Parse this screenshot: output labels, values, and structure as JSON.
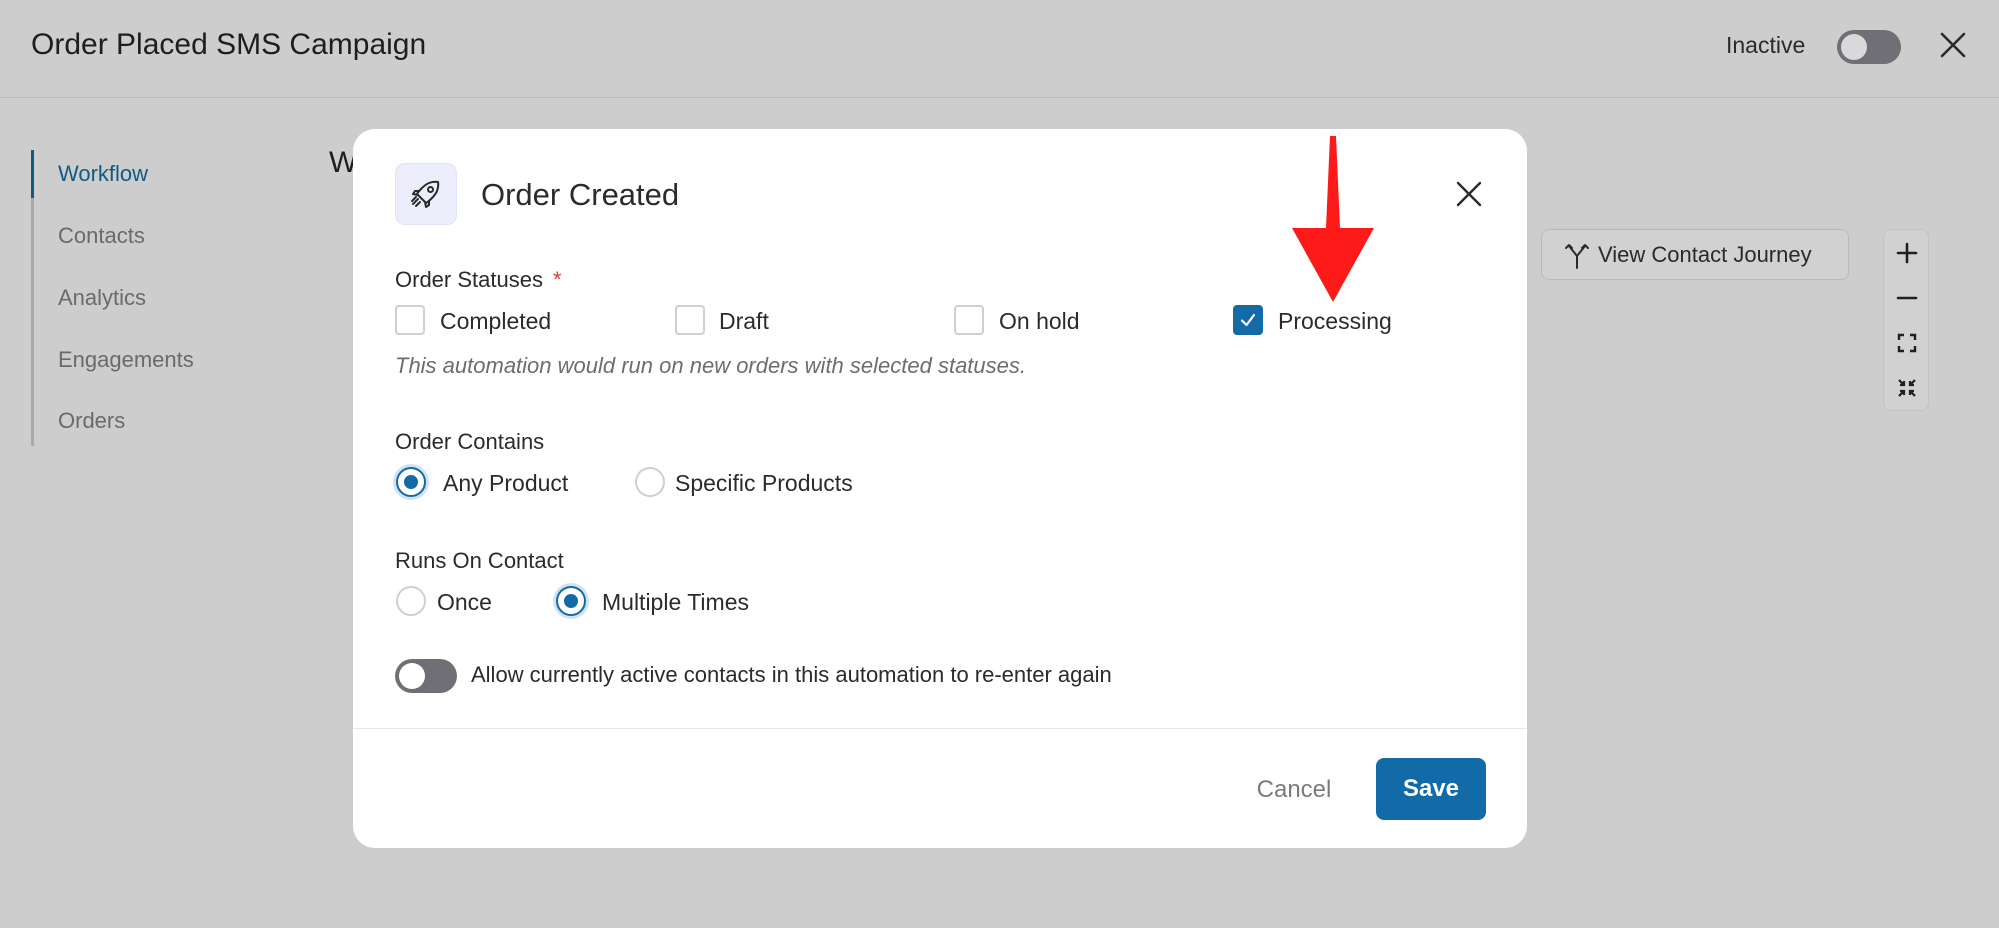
{
  "header": {
    "title": "Order Placed SMS Campaign",
    "status_label": "Inactive"
  },
  "sidebar": {
    "items": [
      {
        "label": "Workflow",
        "active": true
      },
      {
        "label": "Contacts",
        "active": false
      },
      {
        "label": "Analytics",
        "active": false
      },
      {
        "label": "Engagements",
        "active": false
      },
      {
        "label": "Orders",
        "active": false
      }
    ]
  },
  "background": {
    "heading_partial": "W",
    "journey_button": "View Contact Journey"
  },
  "modal": {
    "title": "Order Created",
    "order_statuses": {
      "label": "Order Statuses",
      "required_mark": "*",
      "options": [
        {
          "label": "Completed",
          "checked": false
        },
        {
          "label": "Draft",
          "checked": false
        },
        {
          "label": "On hold",
          "checked": false
        },
        {
          "label": "Processing",
          "checked": true
        }
      ],
      "hint": "This automation would run on new orders with selected statuses."
    },
    "order_contains": {
      "label": "Order Contains",
      "options": [
        {
          "label": "Any Product",
          "selected": true
        },
        {
          "label": "Specific Products",
          "selected": false
        }
      ]
    },
    "runs_on_contact": {
      "label": "Runs On Contact",
      "options": [
        {
          "label": "Once",
          "selected": false
        },
        {
          "label": "Multiple Times",
          "selected": true
        }
      ]
    },
    "reenter": {
      "label": "Allow currently active contacts in this automation to re-enter again",
      "enabled": false
    },
    "cancel_label": "Cancel",
    "save_label": "Save"
  },
  "colors": {
    "accent": "#126ba6",
    "nav_active": "#115b82",
    "required": "#e53e2a",
    "annotation_arrow": "#ff1a1a",
    "overlay": "#cdcdcd"
  },
  "icons": [
    "close-icon",
    "rocket-icon",
    "branch-icon",
    "plus-icon",
    "minus-icon",
    "expand-icon",
    "fit-icon",
    "check-icon"
  ]
}
